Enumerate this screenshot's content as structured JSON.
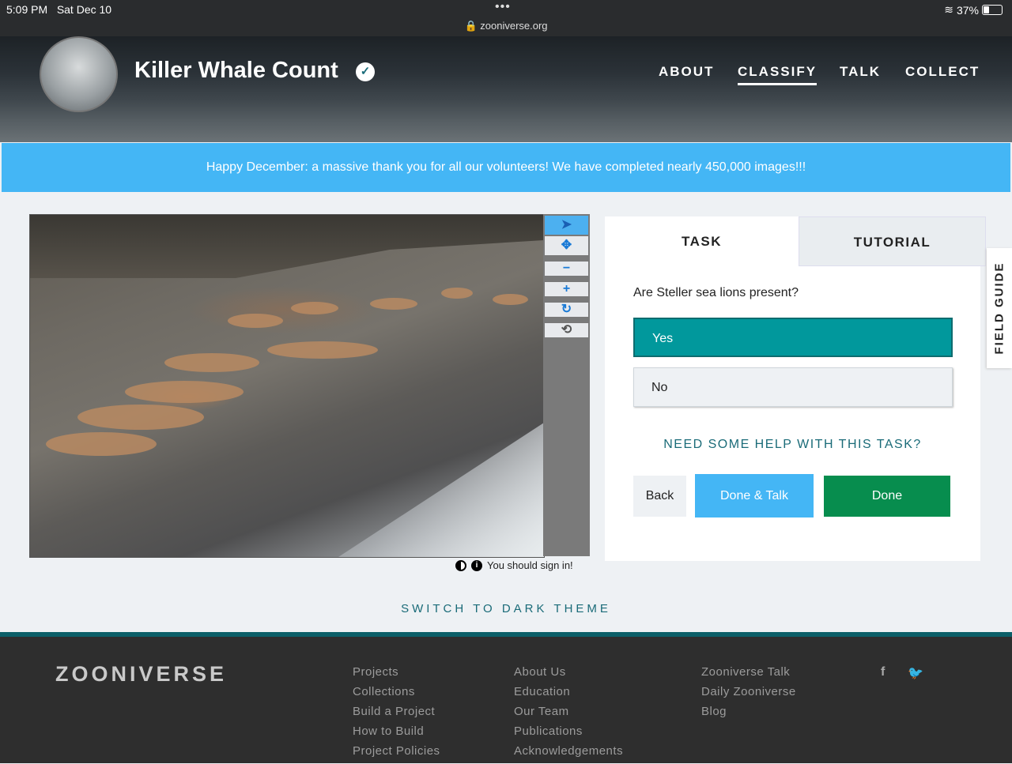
{
  "status_bar": {
    "time": "5:09 PM",
    "date": "Sat Dec 10",
    "url": "zooniverse.org",
    "battery": "37%",
    "battery_level": 0.37
  },
  "project": {
    "title": "Killer Whale Count",
    "nav": [
      "ABOUT",
      "CLASSIFY",
      "TALK",
      "COLLECT"
    ],
    "active_nav": "CLASSIFY"
  },
  "banner": {
    "text": "Happy December: a massive thank you for all our volunteers! We have completed nearly 450,000 images!!!"
  },
  "viewer": {
    "tools": [
      "pointer-icon",
      "move-icon",
      "zoom-out-icon",
      "zoom-in-icon",
      "rotate-icon",
      "reset-icon"
    ],
    "signin_text": "You should sign in!"
  },
  "task_panel": {
    "tabs": [
      "TASK",
      "TUTORIAL"
    ],
    "question": "Are Steller sea lions present?",
    "answers": [
      "Yes",
      "No"
    ],
    "selected_answer": "Yes",
    "help": "NEED SOME HELP WITH THIS TASK?",
    "back": "Back",
    "done_talk": "Done & Talk",
    "done": "Done"
  },
  "field_guide": "FIELD GUIDE",
  "dark_theme": "SWITCH TO DARK THEME",
  "footer": {
    "logo": "ZOONIVERSE",
    "col1": [
      "Projects",
      "Collections",
      "Build a Project",
      "How to Build",
      "Project Policies"
    ],
    "col2": [
      "About Us",
      "Education",
      "Our Team",
      "Publications",
      "Acknowledgements"
    ],
    "col3": [
      "Zooniverse Talk",
      "Daily Zooniverse",
      "Blog"
    ],
    "social": [
      "facebook-icon",
      "twitter-icon"
    ]
  },
  "colors": {
    "accent": "#44b6f5",
    "teal": "#01989c",
    "done_green": "#078d4e",
    "footer_bg": "#2e2e2e"
  }
}
